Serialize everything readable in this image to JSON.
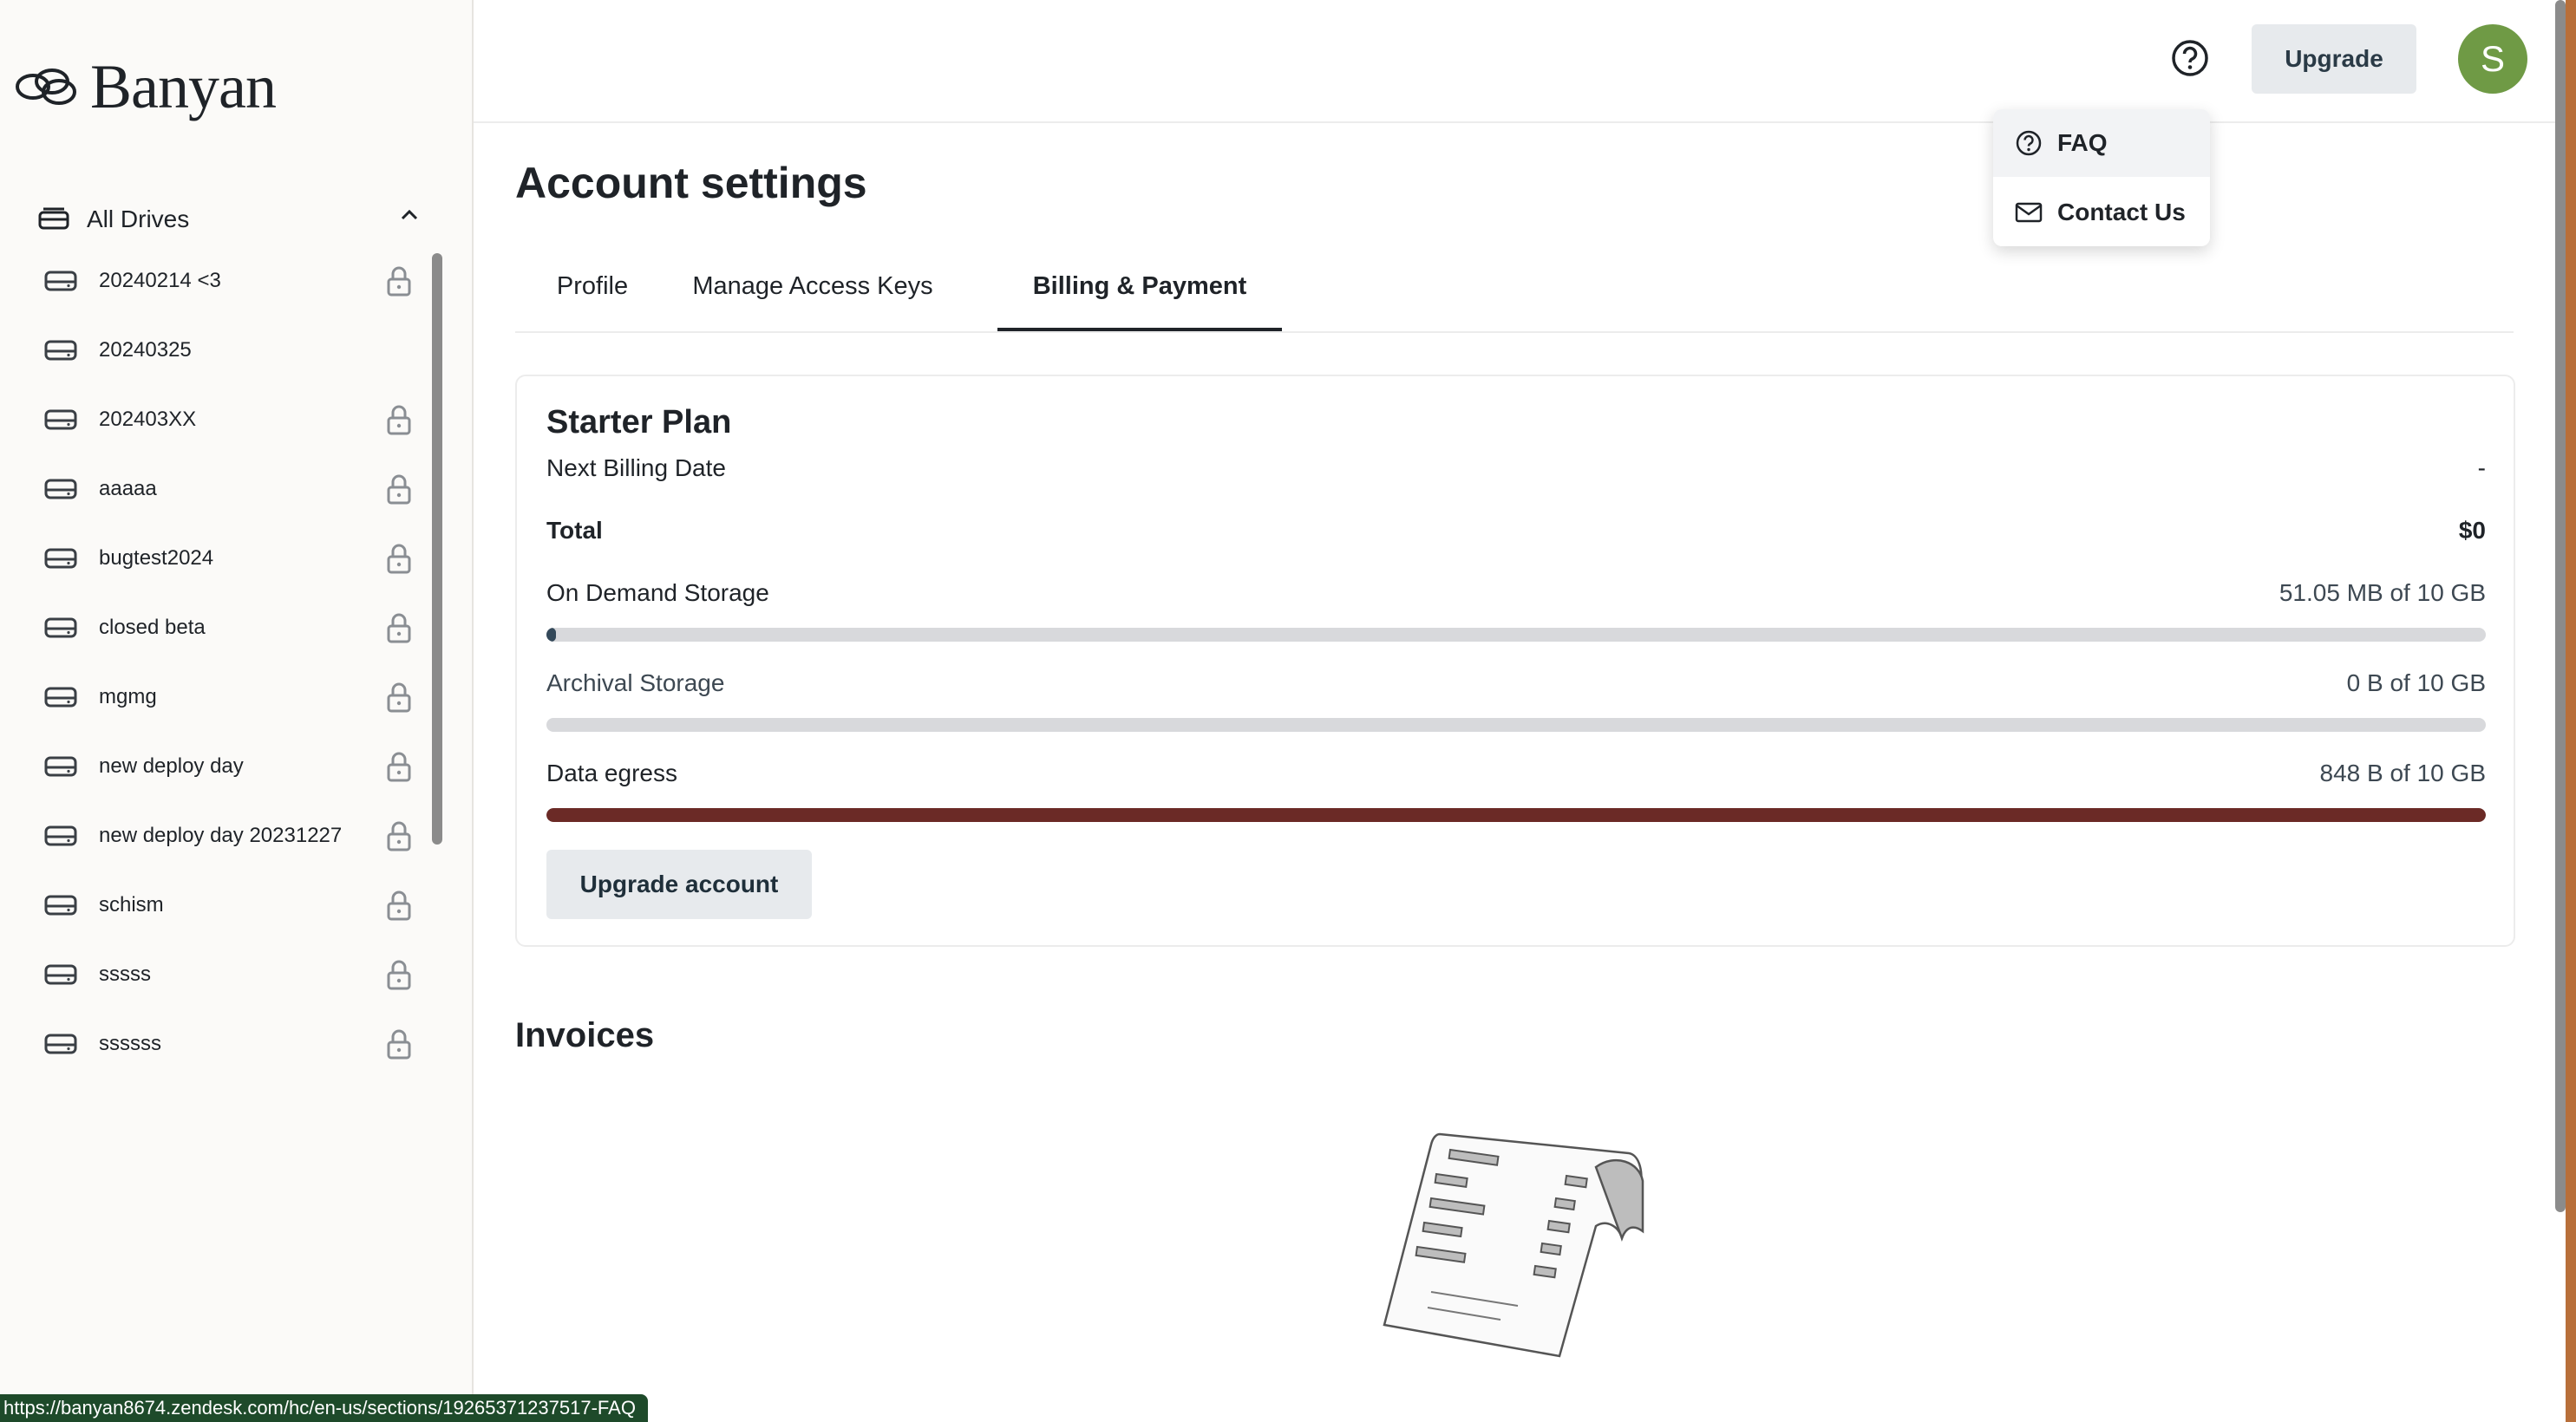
{
  "app": {
    "name": "Banyan",
    "accent": "#1f2328",
    "avatar_color": "#6f9a45"
  },
  "sidebar": {
    "section_label": "All Drives",
    "drives": [
      {
        "name": "20240214 <3",
        "locked": true
      },
      {
        "name": "20240325",
        "locked": false
      },
      {
        "name": "202403XX",
        "locked": true
      },
      {
        "name": "aaaaa",
        "locked": true
      },
      {
        "name": "bugtest2024",
        "locked": true
      },
      {
        "name": "closed beta",
        "locked": true
      },
      {
        "name": "mgmg",
        "locked": true
      },
      {
        "name": "new deploy day",
        "locked": true
      },
      {
        "name": "new deploy day 20231227",
        "locked": true
      },
      {
        "name": "schism",
        "locked": true
      },
      {
        "name": "sssss",
        "locked": true
      },
      {
        "name": "ssssss",
        "locked": true
      }
    ]
  },
  "topbar": {
    "help_icon": "question-circle-icon",
    "upgrade_label": "Upgrade",
    "avatar_initial": "S"
  },
  "help_menu": {
    "items": [
      {
        "label": "FAQ",
        "icon": "question-circle-icon"
      },
      {
        "label": "Contact Us",
        "icon": "mail-icon"
      }
    ]
  },
  "page": {
    "title": "Account settings",
    "tabs": [
      {
        "label": "Profile",
        "active": false
      },
      {
        "label": "Manage Access Keys",
        "active": false
      },
      {
        "label": "Billing & Payment",
        "active": true
      }
    ]
  },
  "plan": {
    "name": "Starter Plan",
    "next_billing_label": "Next Billing Date",
    "next_billing_value": "-",
    "total_label": "Total",
    "total_value": "$0",
    "usage": [
      {
        "label": "On Demand Storage",
        "value": "51.05 MB of 10 GB",
        "fraction": 0.005,
        "color": "#34495a"
      },
      {
        "label": "Archival Storage",
        "value": "0 B of 10 GB",
        "fraction": 0.0,
        "color": "#34495a"
      },
      {
        "label": "Data egress",
        "value": "848 B of 10 GB",
        "fraction": 1.0,
        "color": "#6b2a26"
      }
    ],
    "upgrade_button": "Upgrade account"
  },
  "invoices": {
    "title": "Invoices"
  },
  "status_bar": {
    "url": "https://banyan8674.zendesk.com/hc/en-us/sections/19265371237517-FAQ"
  }
}
